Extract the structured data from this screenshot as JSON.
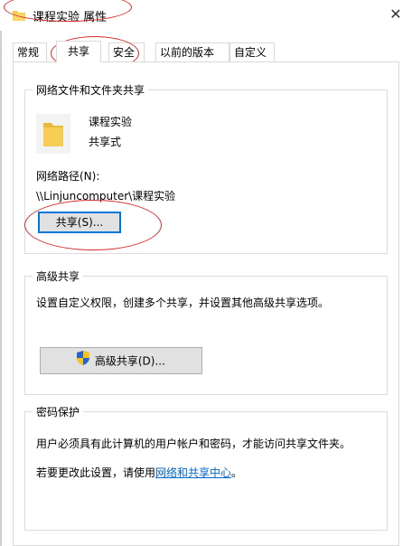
{
  "window": {
    "title": "课程实验 属性",
    "close_symbol": "✕"
  },
  "tabs": [
    {
      "label": "常规"
    },
    {
      "label": "共享"
    },
    {
      "label": "安全"
    },
    {
      "label": "以前的版本"
    },
    {
      "label": "自定义"
    }
  ],
  "active_tab": "共享",
  "network_share": {
    "group_title": "网络文件和文件夹共享",
    "folder_name": "课程实验",
    "share_status": "共享式",
    "path_label": "网络路径(N):",
    "path_value": "\\\\Linjuncomputer\\课程实验",
    "share_button": "共享(S)..."
  },
  "advanced_share": {
    "group_title": "高级共享",
    "description": "设置自定义权限，创建多个共享，并设置其他高级共享选项。",
    "button": "高级共享(D)...",
    "button_icon": "uac-shield-icon"
  },
  "password_protection": {
    "group_title": "密码保护",
    "line1": "用户必须具有此计算机的用户帐户和密码，才能访问共享文件夹。",
    "line2_prefix": "若要更改此设置，请使用",
    "line2_link": "网络和共享中心",
    "line2_suffix": "。"
  },
  "colors": {
    "annotation_red": "#d42b2b",
    "link_blue": "#0066cc",
    "focus_blue": "#0078d7",
    "folder_yellow": "#f7c948"
  }
}
